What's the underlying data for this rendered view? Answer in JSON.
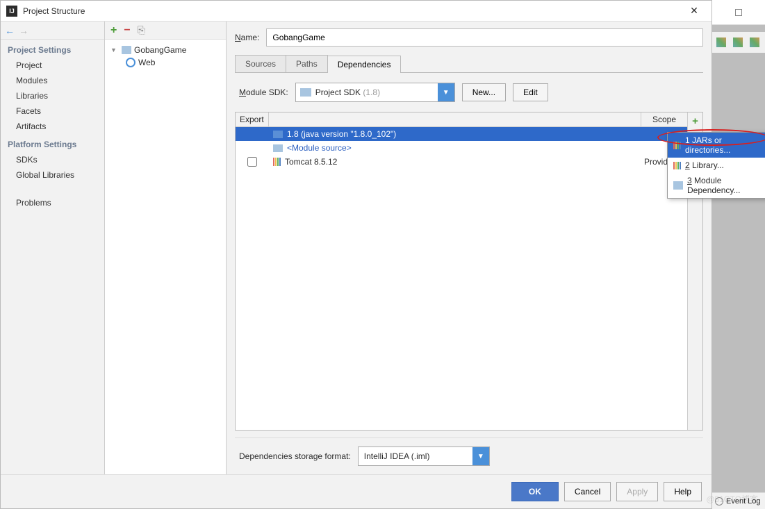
{
  "window": {
    "title": "Project Structure"
  },
  "nav": {
    "project_settings": "Project Settings",
    "items1": [
      "Project",
      "Modules",
      "Libraries",
      "Facets",
      "Artifacts"
    ],
    "platform_settings": "Platform Settings",
    "items2": [
      "SDKs",
      "Global Libraries"
    ],
    "items3": [
      "Problems"
    ]
  },
  "tree": {
    "root": "GobangGame",
    "child": "Web"
  },
  "form": {
    "name_label": "Name:",
    "name_value": "GobangGame",
    "tabs": {
      "sources": "Sources",
      "paths": "Paths",
      "dependencies": "Dependencies"
    },
    "sdk_label": "Module SDK:",
    "sdk_value": "Project SDK",
    "sdk_version": "(1.8)",
    "new_btn": "New...",
    "edit_btn": "Edit"
  },
  "deps": {
    "headers": {
      "export": "Export",
      "scope": "Scope"
    },
    "rows": [
      {
        "label": "1.8 (java version \"1.8.0_102\")",
        "scope": "",
        "type": "folder",
        "selected": true
      },
      {
        "label": "<Module source>",
        "scope": "",
        "type": "folder-blue",
        "selected": false
      },
      {
        "label": "Tomcat 8.5.12",
        "scope": "Provided",
        "type": "lib",
        "selected": false,
        "checkbox": true
      }
    ]
  },
  "storage": {
    "label": "Dependencies storage format:",
    "value": "IntelliJ IDEA (.iml)"
  },
  "buttons": {
    "ok": "OK",
    "cancel": "Cancel",
    "apply": "Apply",
    "help": "Help"
  },
  "popup": {
    "items": [
      {
        "num": "1",
        "text": "JARs or directories..."
      },
      {
        "num": "2",
        "text": "Library..."
      },
      {
        "num": "3",
        "text": "Module Dependency..."
      }
    ]
  },
  "eventlog": "Event Log",
  "watermark": "@51CTO博客"
}
